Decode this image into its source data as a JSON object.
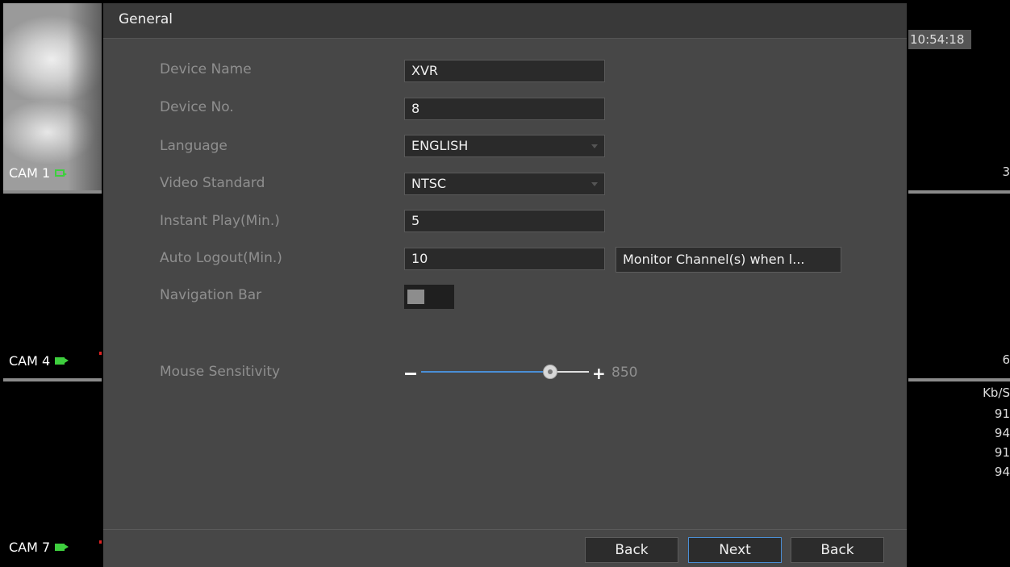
{
  "cameras": {
    "cam1": "CAM 1",
    "cam4": "CAM 4",
    "cam7": "CAM 7"
  },
  "right_panel": {
    "time": "10:54:18",
    "ch_a": "3",
    "ch_b": "6",
    "rate_header": "Kb/S",
    "rates": [
      "91",
      "94",
      "91",
      "94"
    ]
  },
  "dialog": {
    "title": "General",
    "fields": {
      "device_name_label": "Device Name",
      "device_name_value": "XVR",
      "device_no_label": "Device No.",
      "device_no_value": "8",
      "language_label": "Language",
      "language_value": "ENGLISH",
      "video_standard_label": "Video Standard",
      "video_standard_value": "NTSC",
      "instant_play_label": "Instant Play(Min.)",
      "instant_play_value": "5",
      "auto_logout_label": "Auto Logout(Min.)",
      "auto_logout_value": "10",
      "monitor_button": "Monitor Channel(s) when l...",
      "navigation_bar_label": "Navigation Bar",
      "navigation_bar_enabled": false,
      "mouse_sensitivity_label": "Mouse Sensitivity",
      "mouse_sensitivity_value": "850"
    },
    "footer": {
      "back_left": "Back",
      "next": "Next",
      "back_right": "Back"
    }
  },
  "colors": {
    "accent": "#4a8fd6",
    "record_icon": "#3ecf3e"
  }
}
